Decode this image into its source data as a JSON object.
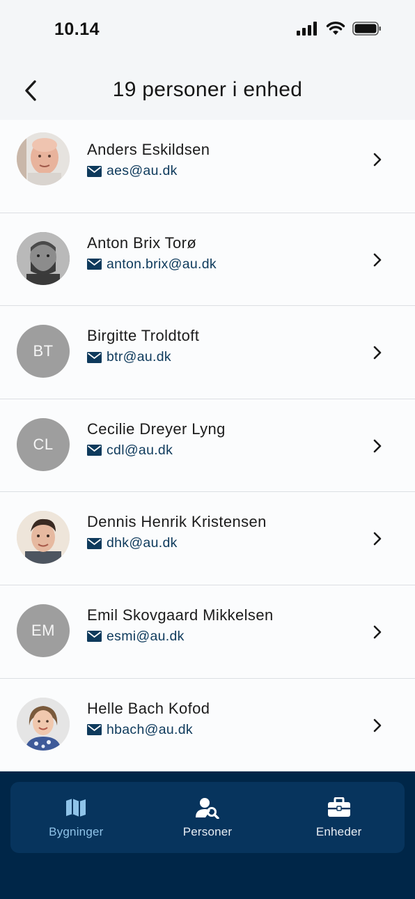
{
  "status_bar": {
    "time": "10.14"
  },
  "header": {
    "title": "19 personer i enhed"
  },
  "people": [
    {
      "name": "Anders Eskildsen",
      "email": "aes@au.dk",
      "initials": "",
      "photo": "photo-bald-man"
    },
    {
      "name": "Anton Brix Torø",
      "email": "anton.brix@au.dk",
      "initials": "",
      "photo": "photo-bearded-man"
    },
    {
      "name": "Birgitte Troldtoft",
      "email": "btr@au.dk",
      "initials": "BT",
      "photo": ""
    },
    {
      "name": "Cecilie Dreyer Lyng",
      "email": "cdl@au.dk",
      "initials": "CL",
      "photo": ""
    },
    {
      "name": "Dennis Henrik Kristensen",
      "email": "dhk@au.dk",
      "initials": "",
      "photo": "photo-young-man"
    },
    {
      "name": "Emil Skovgaard Mikkelsen",
      "email": "esmi@au.dk",
      "initials": "EM",
      "photo": ""
    },
    {
      "name": "Helle Bach Kofod",
      "email": "hbach@au.dk",
      "initials": "",
      "photo": "photo-woman"
    }
  ],
  "tabs": [
    {
      "label": "Bygninger",
      "icon": "map-icon",
      "active": true
    },
    {
      "label": "Personer",
      "icon": "person-search-icon",
      "active": false
    },
    {
      "label": "Enheder",
      "icon": "briefcase-icon",
      "active": false
    }
  ],
  "colors": {
    "accent": "#0e3a5c",
    "nav_background": "#002648",
    "tab_bar": "#07345d",
    "active_tab": "#8fc3e8",
    "avatar_gray": "#9e9e9e"
  }
}
